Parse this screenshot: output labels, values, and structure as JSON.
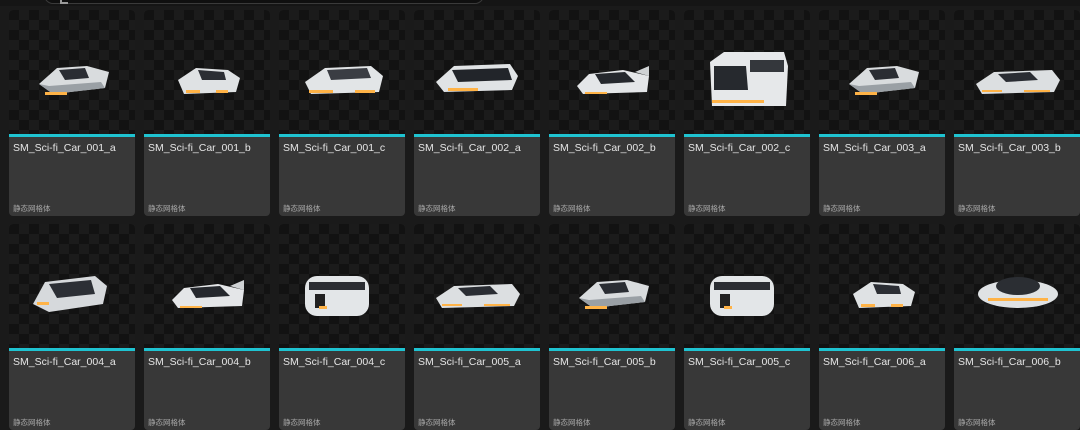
{
  "asset_type_label": "静态网格体",
  "accent_color": "#1fc3d1",
  "glow_color": "#ffb347",
  "assets": [
    {
      "name": "SM_Sci-fi_Car_001_a",
      "variant": "wedge"
    },
    {
      "name": "SM_Sci-fi_Car_001_b",
      "variant": "compact"
    },
    {
      "name": "SM_Sci-fi_Car_001_c",
      "variant": "sedan"
    },
    {
      "name": "SM_Sci-fi_Car_002_a",
      "variant": "sedan-dark"
    },
    {
      "name": "SM_Sci-fi_Car_002_b",
      "variant": "sport"
    },
    {
      "name": "SM_Sci-fi_Car_002_c",
      "variant": "van"
    },
    {
      "name": "SM_Sci-fi_Car_003_a",
      "variant": "wedge"
    },
    {
      "name": "SM_Sci-fi_Car_003_b",
      "variant": "flat"
    },
    {
      "name": "SM_Sci-fi_Car_004_a",
      "variant": "pod"
    },
    {
      "name": "SM_Sci-fi_Car_004_b",
      "variant": "sport"
    },
    {
      "name": "SM_Sci-fi_Car_004_c",
      "variant": "bus"
    },
    {
      "name": "SM_Sci-fi_Car_005_a",
      "variant": "flat"
    },
    {
      "name": "SM_Sci-fi_Car_005_b",
      "variant": "wedge"
    },
    {
      "name": "SM_Sci-fi_Car_005_c",
      "variant": "bus"
    },
    {
      "name": "SM_Sci-fi_Car_006_a",
      "variant": "compact"
    },
    {
      "name": "SM_Sci-fi_Car_006_b",
      "variant": "saucer"
    }
  ]
}
